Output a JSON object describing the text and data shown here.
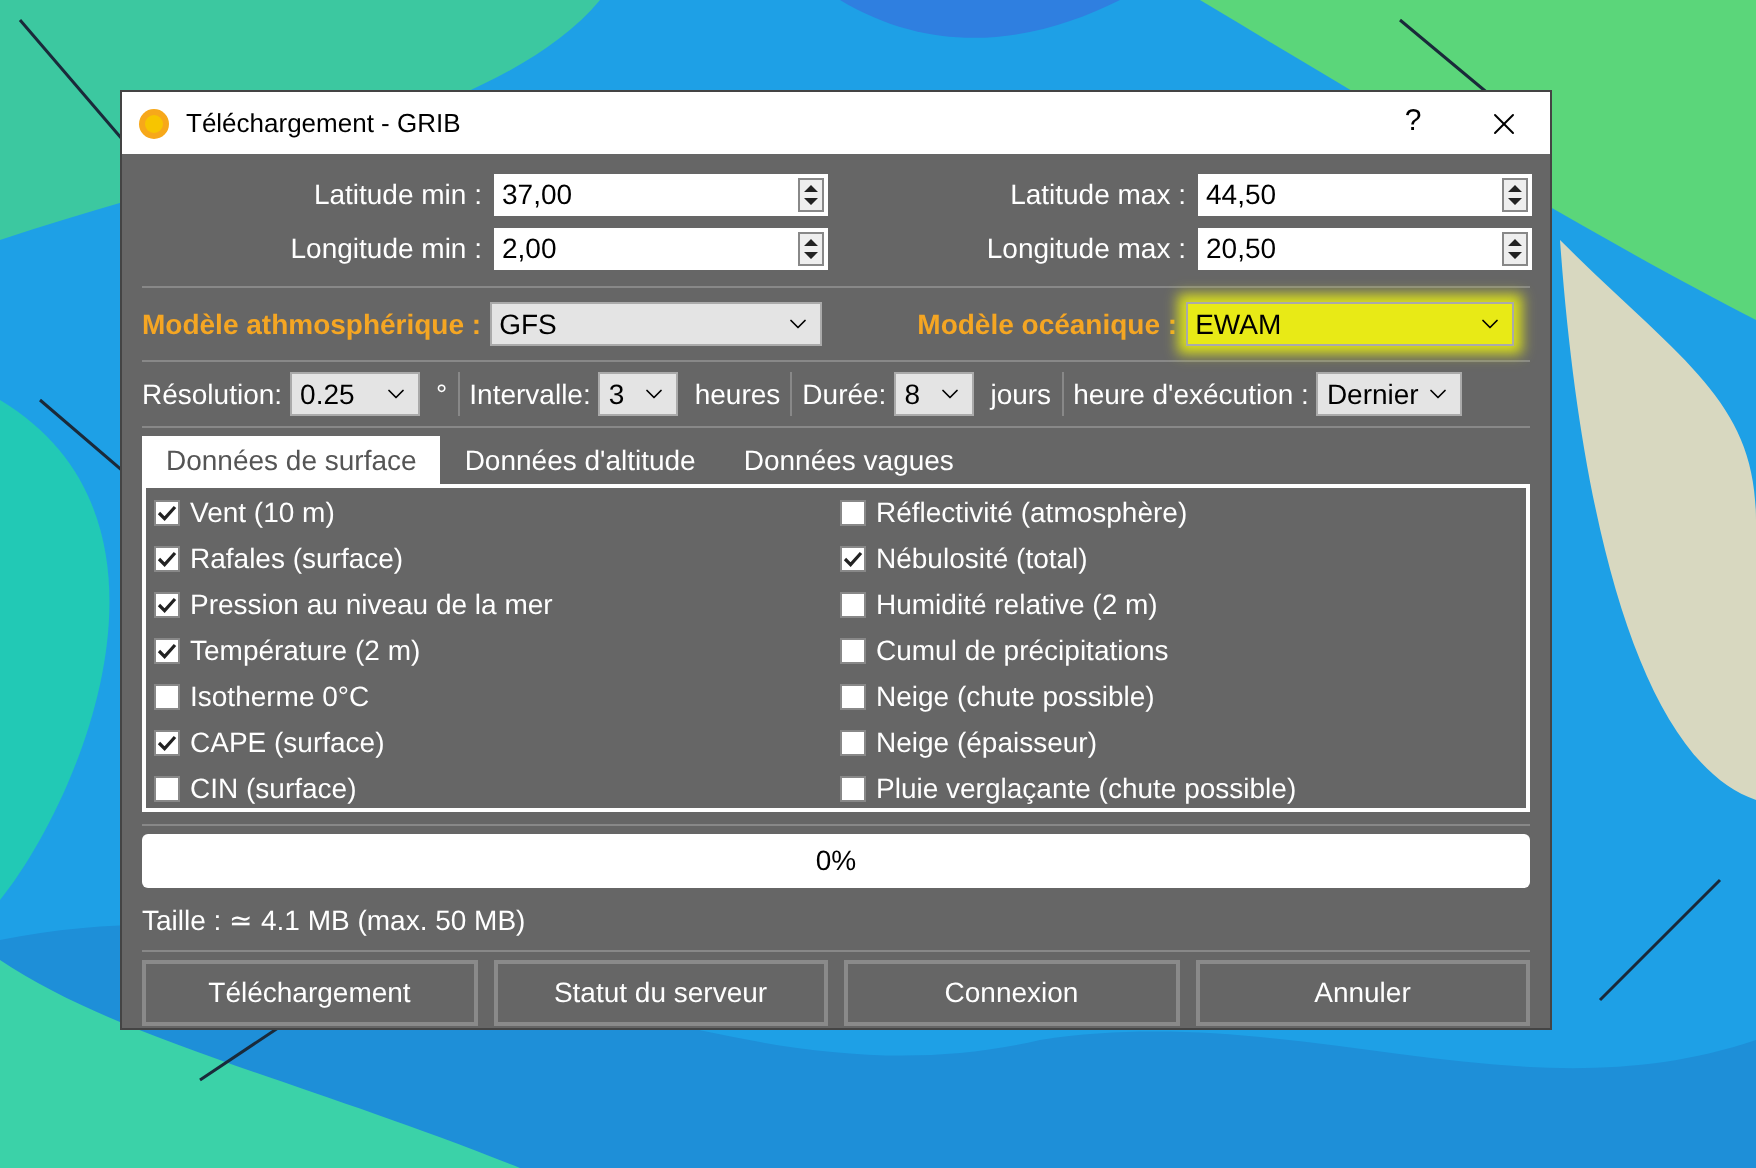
{
  "window": {
    "title": "Téléchargement - GRIB",
    "help": "?"
  },
  "coordinates": [
    {
      "left": {
        "label": "Latitude min :",
        "value": "37,00"
      },
      "right": {
        "label": "Latitude max :",
        "value": "44,50"
      }
    },
    {
      "left": {
        "label": "Longitude min :",
        "value": "2,00"
      },
      "right": {
        "label": "Longitude max :",
        "value": "20,50"
      }
    }
  ],
  "models": [
    {
      "label": "Modèle athmosphérique :",
      "value": "GFS",
      "highlighted": false
    },
    {
      "label": "Modèle océanique :",
      "value": "EWAM",
      "highlighted": true
    }
  ],
  "settings": [
    {
      "label": "Résolution:",
      "value": "0.25",
      "unit": "°"
    },
    {
      "label": "Intervalle:",
      "value": "3",
      "unit": "heures"
    },
    {
      "label": "Durée:",
      "value": "8",
      "unit": "jours"
    },
    {
      "label": "heure d'exécution :",
      "value": "Dernier"
    }
  ],
  "tabs": [
    {
      "label": "Données de surface",
      "selected": true
    },
    {
      "label": "Données d'altitude",
      "selected": false
    },
    {
      "label": "Données vagues",
      "selected": false
    }
  ],
  "parameter_columns": [
    [
      {
        "label": "Vent (10 m)",
        "checked": true
      },
      {
        "label": "Rafales (surface)",
        "checked": true
      },
      {
        "label": "Pression au niveau de la mer",
        "checked": true
      },
      {
        "label": "Température (2 m)",
        "checked": true
      },
      {
        "label": "Isotherme 0°C",
        "checked": false
      },
      {
        "label": "CAPE (surface)",
        "checked": true
      },
      {
        "label": "CIN (surface)",
        "checked": false
      }
    ],
    [
      {
        "label": "Réflectivité (atmosphère)",
        "checked": false
      },
      {
        "label": "Nébulosité (total)",
        "checked": true
      },
      {
        "label": "Humidité relative (2 m)",
        "checked": false
      },
      {
        "label": "Cumul de précipitations",
        "checked": false
      },
      {
        "label": "Neige (chute possible)",
        "checked": false
      },
      {
        "label": "Neige (épaisseur)",
        "checked": false
      },
      {
        "label": "Pluie verglaçante (chute possible)",
        "checked": false
      }
    ]
  ],
  "progress": {
    "level": 0,
    "text": "0%"
  },
  "size": "Taille : ≃ 4.1 MB (max. 50 MB)",
  "buttons": [
    "Téléchargement",
    "Statut du serveur",
    "Connexion",
    "Annuler"
  ]
}
